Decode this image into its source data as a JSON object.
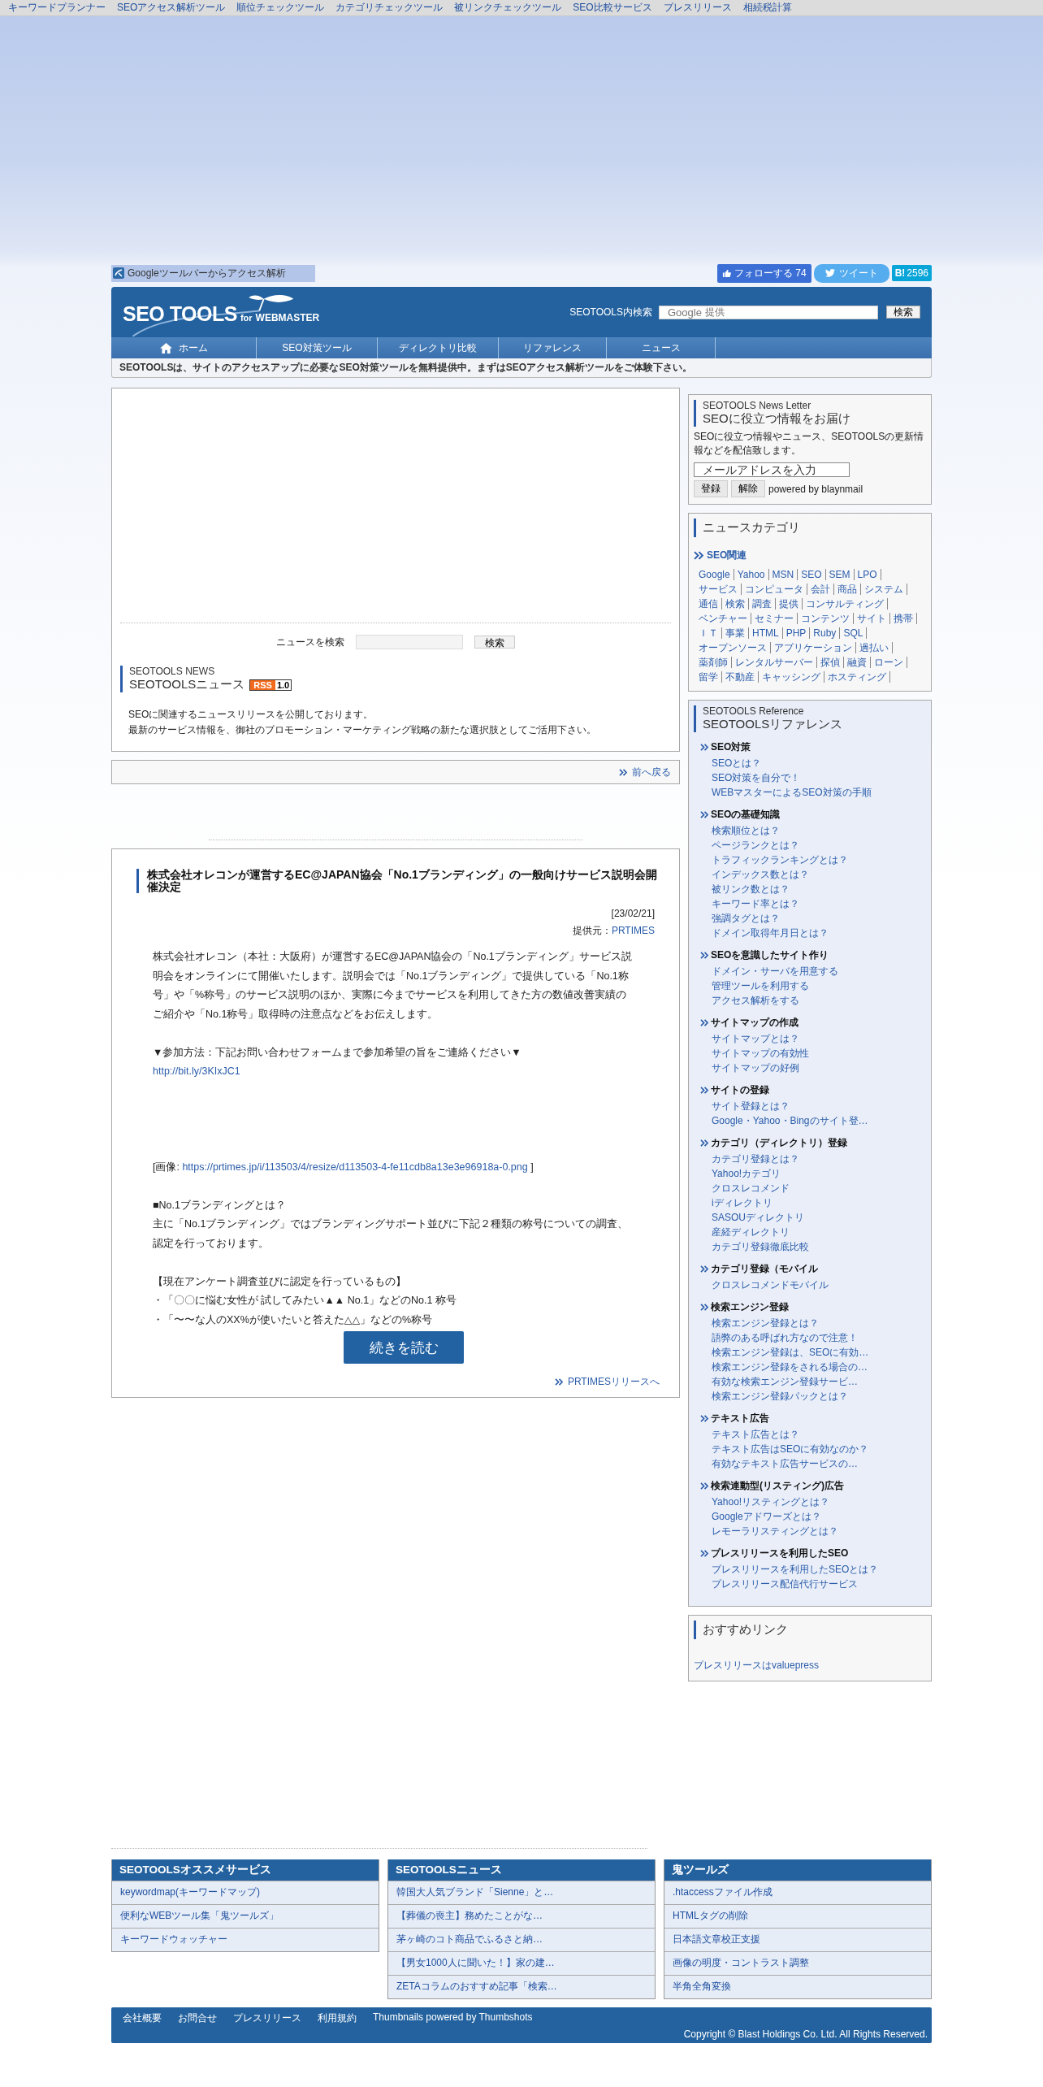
{
  "top_links": [
    "キーワードプランナー",
    "SEOアクセス解析ツール",
    "順位チェックツール",
    "カテゴリチェックツール",
    "被リンクチェックツール",
    "SEO比較サービス",
    "プレスリリース",
    "相続税計算"
  ],
  "toolbar_link": "Googleツールバーからアクセス解析",
  "social": {
    "follow": "フォローする",
    "follow_count": "74",
    "tweet": "ツイート",
    "hatena": "B!",
    "hatena_count": "2596"
  },
  "header": {
    "logo_main": "SEO TOOLS",
    "logo_for": "for",
    "logo_sub": "WEBMASTER",
    "search_label": "SEOTOOLS内検索",
    "search_brand": "Google",
    "search_hint": "提供",
    "search_button": "検索"
  },
  "nav": [
    {
      "label": "ホーム",
      "kind": "home",
      "selected": false
    },
    {
      "label": "SEO対策ツール",
      "kind": "plain",
      "selected": false
    },
    {
      "label": "ディレクトリ比較",
      "kind": "plain",
      "selected": false
    },
    {
      "label": "リファレンス",
      "kind": "plain",
      "selected": false
    },
    {
      "label": "ニュース",
      "kind": "plain",
      "selected": false
    }
  ],
  "tagline": "SEOTOOLSは、サイトのアクセスアップに必要なSEO対策ツールを無料提供中。まずはSEOアクセス解析ツールをご体験下さい。",
  "news_search": {
    "label": "ニュースを検索",
    "button": "検索"
  },
  "news_header": {
    "subtitle": "SEOTOOLS NEWS",
    "title": "SEOTOOLSニュース",
    "rss": "RSS",
    "rss_version": "1.0"
  },
  "news_intro": [
    "SEOに関連するニュースリリースを公開しております。",
    "最新のサービス情報を、御社のプロモーション・マーケティング戦略の新たな選択肢としてご活用下さい。"
  ],
  "back_link": "前へ戻る",
  "article": {
    "title": "株式会社オレコンが運営するEC@JAPAN協会「No.1ブランディング」の一般向けサービス説明会開催決定",
    "date": "[23/02/21]",
    "source_label": "提供元：",
    "source": "PRTIMES",
    "blocks": [
      {
        "kind": "text",
        "text": "株式会社オレコン（本社：大阪府）が運営するEC@JAPAN協会の「No.1ブランディング」サービス説明会をオンラインにて開催いたします。説明会では「No.1ブランディング」で提供している「No.1称号」や「%称号」のサービス説明のほか、実際に今までサービスを利用してきた方の数値改善実績のご紹介や「No.1称号」取得時の注意点などをお伝えします。"
      },
      {
        "kind": "gap"
      },
      {
        "kind": "text",
        "text": "▼参加方法：下記お問い合わせフォームまで参加希望の旨をご連絡ください▼"
      },
      {
        "kind": "link",
        "text": "http://bit.ly/3KIxJC1"
      },
      {
        "kind": "space"
      },
      {
        "kind": "image_ref",
        "prefix": "[画像: ",
        "text": "https://prtimes.jp/i/113503/4/resize/d113503-4-fe11cdb8a13e3e96918a-0.png",
        "suffix": " ]"
      },
      {
        "kind": "gap"
      },
      {
        "kind": "text",
        "text": "■No.1ブランディングとは？"
      },
      {
        "kind": "text",
        "text": "主に「No.1ブランディング」ではブランディングサポート並びに下記２種類の称号についての調査、認定を行っております。"
      },
      {
        "kind": "gap"
      },
      {
        "kind": "text",
        "text": "【現在アンケート調査並びに認定を行っているもの】"
      },
      {
        "kind": "text",
        "text": "・「〇〇に悩む女性が 試してみたい▲▲ No.1」などのNo.1 称号"
      },
      {
        "kind": "text",
        "text": "・「〜〜な人のXX%が使いたいと答えた△△」などの%称号"
      }
    ],
    "read_more": "続きを読む",
    "prtimes_link": "PRTIMESリリースへ"
  },
  "newsletter": {
    "subtitle": "SEOTOOLS News Letter",
    "title": "SEOに役立つ情報をお届け",
    "description": "SEOに役立つ情報やニュース、SEOTOOLSの更新情報などを配信致します。",
    "placeholder": "メールアドレスを入力",
    "buttons": [
      "登録",
      "解除"
    ],
    "powered": "powered by blaynmail"
  },
  "categories": {
    "title": "ニュースカテゴリ",
    "group": "SEO関連",
    "tags": [
      "Google",
      "Yahoo",
      "MSN",
      "SEO",
      "SEM",
      "LPO",
      "サービス",
      "コンピュータ",
      "会計",
      "商品",
      "システム",
      "通信",
      "検索",
      "調査",
      "提供",
      "コンサルティング",
      "ベンチャー",
      "セミナー",
      "コンテンツ",
      "サイト",
      "携帯",
      "ＩＴ",
      "事業",
      "HTML",
      "PHP",
      "Ruby",
      "SQL",
      "オープンソース",
      "アプリケーション",
      "過払い",
      "薬剤師",
      "レンタルサーバー",
      "探偵",
      "融資",
      "ローン",
      "留学",
      "不動産",
      "キャッシング",
      "ホスティング"
    ]
  },
  "reference": {
    "subtitle": "SEOTOOLS Reference",
    "title": "SEOTOOLSリファレンス",
    "sections": [
      {
        "heading": "SEO対策",
        "links": [
          "SEOとは？",
          "SEO対策を自分で！",
          "WEBマスターによるSEO対策の手順"
        ]
      },
      {
        "heading": "SEOの基礎知識",
        "links": [
          "検索順位とは？",
          "ページランクとは？",
          "トラフィックランキングとは？",
          "インデックス数とは？",
          "被リンク数とは？",
          "キーワード率とは？",
          "強調タグとは？",
          "ドメイン取得年月日とは？"
        ]
      },
      {
        "heading": "SEOを意識したサイト作り",
        "links": [
          "ドメイン・サーバを用意する",
          "管理ツールを利用する",
          "アクセス解析をする"
        ]
      },
      {
        "heading": "サイトマップの作成",
        "links": [
          "サイトマップとは？",
          "サイトマップの有効性",
          "サイトマップの好例"
        ]
      },
      {
        "heading": "サイトの登録",
        "links": [
          "サイト登録とは？",
          "Google・Yahoo・Bingのサイト登…"
        ]
      },
      {
        "heading": "カテゴリ（ディレクトリ）登録",
        "links": [
          "カテゴリ登録とは？",
          "Yahoo!カテゴリ",
          "クロスレコメンド",
          "iディレクトリ",
          "SASOUディレクトリ",
          "産経ディレクトリ",
          "カテゴリ登録徹底比較"
        ]
      },
      {
        "heading": "カテゴリ登録（モバイル",
        "links": [
          "クロスレコメンドモバイル"
        ]
      },
      {
        "heading": "検索エンジン登録",
        "links": [
          "検索エンジン登録とは？",
          "語弊のある呼ばれ方なので注意！",
          "検索エンジン登録は、SEOに有効…",
          "検索エンジン登録をされる場合の…",
          "有効な検索エンジン登録サービ…",
          "検索エンジン登録パックとは？"
        ]
      },
      {
        "heading": "テキスト広告",
        "links": [
          "テキスト広告とは？",
          "テキスト広告はSEOに有効なのか？",
          "有効なテキスト広告サービスの…"
        ]
      },
      {
        "heading": "検索連動型(リスティング)広告",
        "links": [
          "Yahoo!リスティングとは？",
          "Googleアドワーズとは？",
          "レモーラリスティングとは？"
        ]
      },
      {
        "heading": "プレスリリースを利用したSEO",
        "links": [
          "プレスリリースを利用したSEOとは？",
          "プレスリリース配信代行サービス"
        ]
      }
    ]
  },
  "recommended": {
    "title": "おすすめリンク",
    "links": [
      "プレスリリースはvaluepress"
    ]
  },
  "footer_columns": [
    {
      "title": "SEOTOOLSオススメサービス",
      "items": [
        "keywordmap(キーワードマップ)",
        "便利なWEBツール集「鬼ツールズ」",
        "キーワードウォッチャー"
      ]
    },
    {
      "title": "SEOTOOLSニュース",
      "items": [
        "韓国大人気ブランド「Sienne」と…",
        "【葬儀の喪主】務めたことがな…",
        "茅ヶ崎のコト商品でふるさと納…",
        "【男女1000人に聞いた！】家の建…",
        "ZETAコラムのおすすめ記事「検索…"
      ]
    },
    {
      "title": "鬼ツールズ",
      "items": [
        ".htaccessファイル作成",
        "HTMLタグの削除",
        "日本語文章校正支援",
        "画像の明度・コントラスト調整",
        "半角全角変換"
      ]
    }
  ],
  "footer": {
    "links": [
      "会社概要",
      "お問合せ",
      "プレスリリース",
      "利用規約"
    ],
    "credit": "Thumbnails powered by Thumbshots",
    "copyright": "Copyright © Blast Holdings Co. Ltd. All Rights Reserved."
  }
}
